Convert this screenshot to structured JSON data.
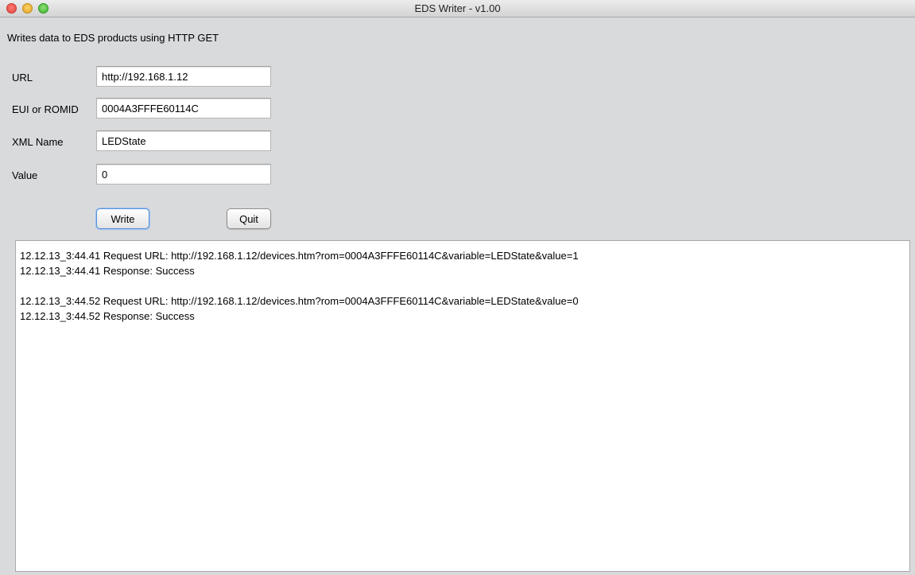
{
  "window": {
    "title": "EDS Writer - v1.00"
  },
  "subtitle": "Writes data to EDS products using HTTP GET",
  "form": {
    "url": {
      "label": "URL",
      "value": "http://192.168.1.12"
    },
    "eui": {
      "label": "EUI or ROMID",
      "value": "0004A3FFFE60114C"
    },
    "xml_name": {
      "label": "XML Name",
      "value": "LEDState"
    },
    "value": {
      "label": "Value",
      "value": "0"
    }
  },
  "buttons": {
    "write_label": "Write",
    "quit_label": "Quit"
  },
  "log": {
    "lines": [
      "12.12.13_3:44.41 Request URL: http://192.168.1.12/devices.htm?rom=0004A3FFFE60114C&variable=LEDState&value=1",
      "12.12.13_3:44.41 Response: Success",
      "",
      "12.12.13_3:44.52 Request URL: http://192.168.1.12/devices.htm?rom=0004A3FFFE60114C&variable=LEDState&value=0",
      "12.12.13_3:44.52 Response: Success"
    ]
  }
}
